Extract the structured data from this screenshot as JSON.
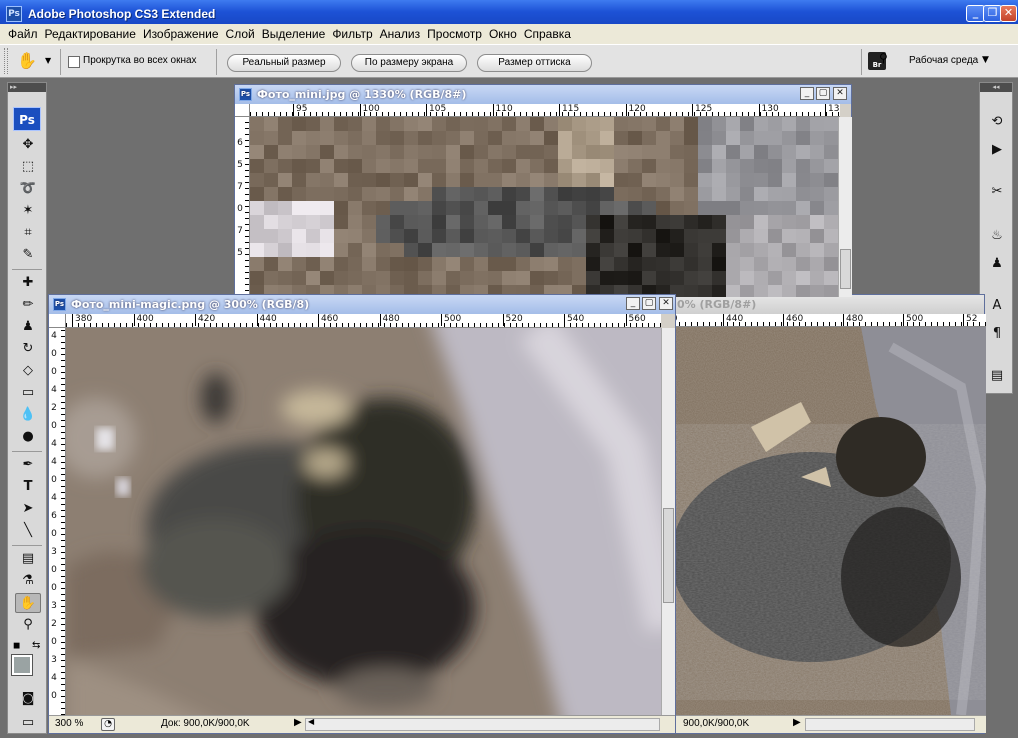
{
  "app": {
    "title": "Adobe Photoshop CS3 Extended",
    "logo": "Ps"
  },
  "menu": [
    "Файл",
    "Редактирование",
    "Изображение",
    "Слой",
    "Выделение",
    "Фильтр",
    "Анализ",
    "Просмотр",
    "Окно",
    "Справка"
  ],
  "options": {
    "scroll_all_label": "Прокрутка во всех окнах",
    "actual_pixels": "Реальный размер",
    "fit_screen": "По размеру экрана",
    "print_size": "Размер оттиска",
    "workspace": "Рабочая среда",
    "bridge_badge": "Br"
  },
  "doc1": {
    "title": "Фото_mini.jpg @ 1330% (RGB/8#)",
    "ruler_h": [
      "95",
      "100",
      "105",
      "110",
      "115",
      "120",
      "125",
      "130",
      "135"
    ],
    "ruler_v": [
      "6",
      "5",
      "7",
      "0",
      "7",
      "5"
    ]
  },
  "doc2": {
    "title": "Фото_mini-magic.png @ 300% (RGB/8)",
    "ruler_h": [
      "380",
      "400",
      "420",
      "440",
      "460",
      "480",
      "500",
      "520",
      "540",
      "560"
    ],
    "ruler_v": [
      "4",
      "0",
      "0",
      "4",
      "2",
      "0",
      "4",
      "4",
      "0",
      "4",
      "6",
      "0",
      "3",
      "0",
      "0",
      "3",
      "2",
      "0",
      "3",
      "4",
      "0"
    ],
    "zoom": "300 %",
    "doc_info": "Док: 900,0K/900,0K"
  },
  "doc3": {
    "title_fragment": "0% (RGB/8#)",
    "ruler_h": [
      "00",
      "440",
      "460",
      "480",
      "500",
      "52"
    ],
    "doc_info": "900,0K/900,0K"
  },
  "colors": {
    "accent": "#1d52d6",
    "foreground_swatch": "#000000",
    "background_swatch": "#9aa3a3"
  }
}
